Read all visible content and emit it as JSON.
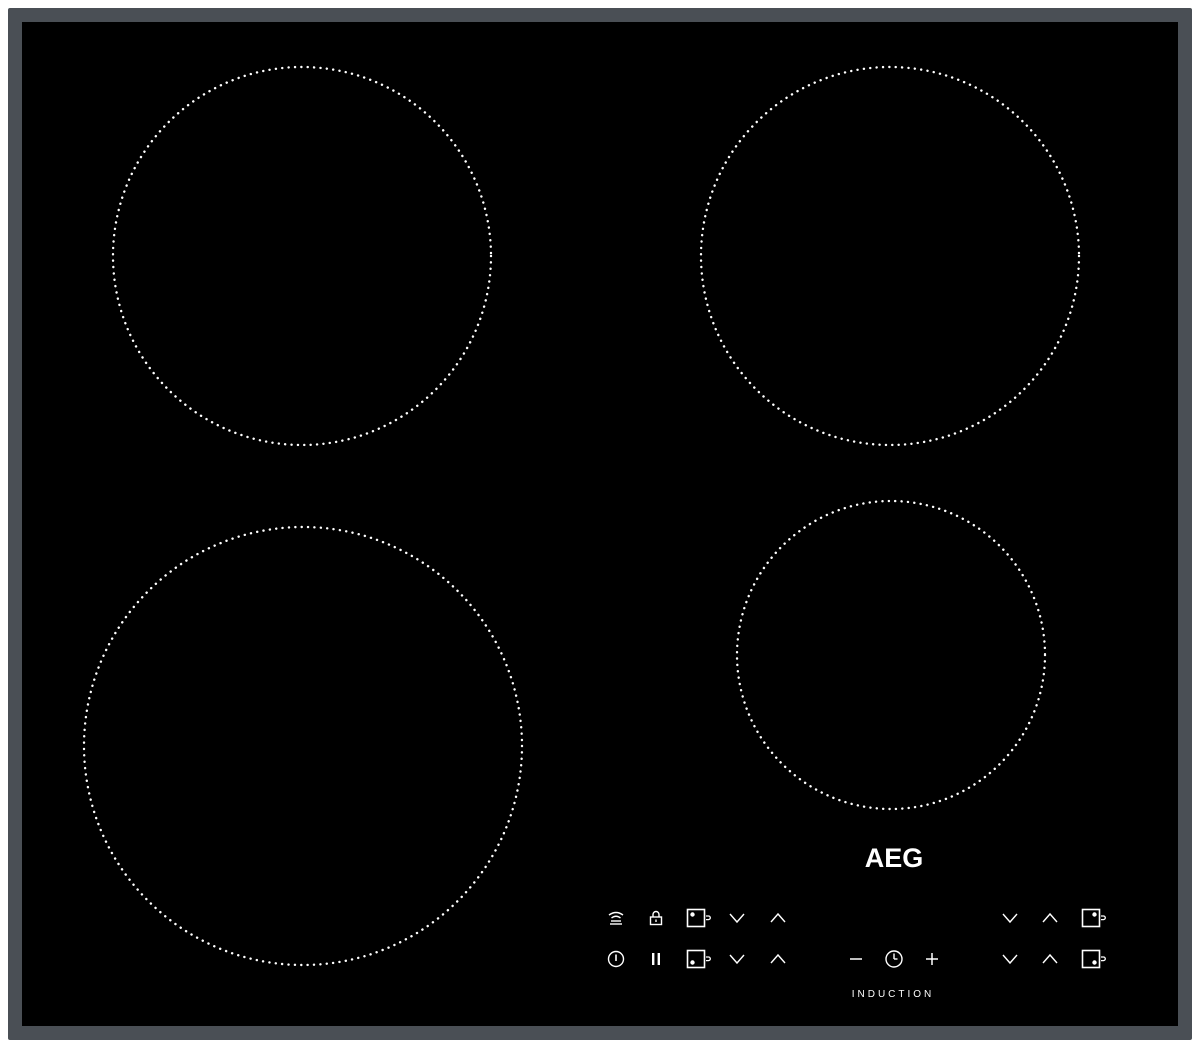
{
  "brand": {
    "name": "AEG",
    "label": "INDUCTION"
  },
  "colors": {
    "glass": "#000000",
    "frame": "#4a4f55",
    "print": "#ffffff"
  },
  "cooking_zones": [
    "zone-rear-left",
    "zone-rear-right",
    "zone-front-left",
    "zone-front-right"
  ],
  "controls": {
    "row_top": [
      "wifi-icon",
      "lock-icon",
      "zone-select-icon",
      "chevron-down-icon",
      "chevron-up-icon",
      "chevron-down-icon",
      "chevron-up-icon",
      "zone-select-icon"
    ],
    "row_bottom": [
      "power-icon",
      "pause-icon",
      "zone-select-icon",
      "chevron-down-icon",
      "chevron-up-icon",
      "minus-icon",
      "timer-icon",
      "plus-icon",
      "chevron-down-icon",
      "chevron-up-icon",
      "zone-select-icon"
    ]
  }
}
